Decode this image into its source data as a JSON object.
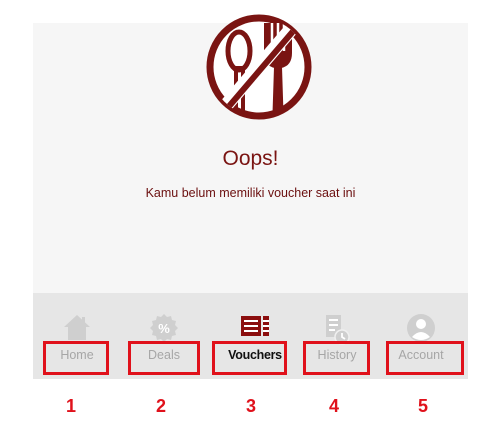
{
  "empty_state": {
    "icon": "no-food-icon",
    "title": "Oops!",
    "message": "Kamu belum memiliki voucher saat ini"
  },
  "nav": {
    "items": [
      {
        "label": "Home",
        "icon": "home-icon",
        "active": false
      },
      {
        "label": "Deals",
        "icon": "percent-badge-icon",
        "active": false
      },
      {
        "label": "Vouchers",
        "icon": "voucher-list-icon",
        "active": true
      },
      {
        "label": "History",
        "icon": "history-document-icon",
        "active": false
      },
      {
        "label": "Account",
        "icon": "account-icon",
        "active": false
      }
    ]
  },
  "annotations": [
    "1",
    "2",
    "3",
    "4",
    "5"
  ],
  "colors": {
    "accent": "#7a1412",
    "active_icon": "#8b0e0e",
    "inactive": "#a6a6a6",
    "annotation": "#e0111b"
  }
}
